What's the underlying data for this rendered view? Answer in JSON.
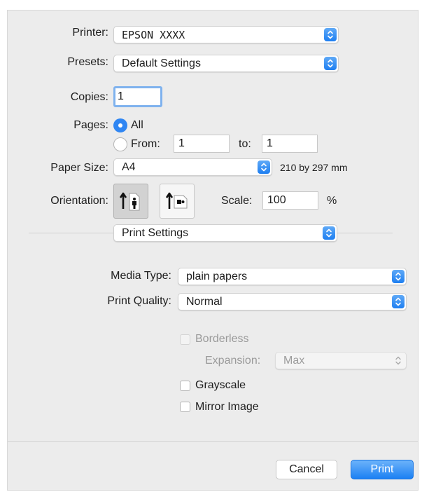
{
  "printer": {
    "label": "Printer:",
    "value": "EPSON XXXX"
  },
  "presets": {
    "label": "Presets:",
    "value": "Default Settings"
  },
  "copies": {
    "label": "Copies:",
    "value": "1"
  },
  "pages": {
    "label": "Pages:",
    "all_label": "All",
    "from_label": "From:",
    "from_value": "1",
    "to_label": "to:",
    "to_value": "1",
    "selected": "All"
  },
  "paper_size": {
    "label": "Paper Size:",
    "value": "A4",
    "dimensions": "210 by 297 mm"
  },
  "orientation": {
    "label": "Orientation:",
    "selected": "portrait",
    "options": [
      "portrait",
      "landscape"
    ]
  },
  "scale": {
    "label": "Scale:",
    "value": "100",
    "unit": "%"
  },
  "section": {
    "value": "Print Settings"
  },
  "media_type": {
    "label": "Media Type:",
    "value": "plain papers"
  },
  "print_quality": {
    "label": "Print Quality:",
    "value": "Normal"
  },
  "borderless": {
    "label": "Borderless",
    "checked": false,
    "enabled": false
  },
  "expansion": {
    "label": "Expansion:",
    "value": "Max",
    "enabled": false
  },
  "grayscale": {
    "label": "Grayscale",
    "checked": false
  },
  "mirror_image": {
    "label": "Mirror Image",
    "checked": false
  },
  "buttons": {
    "cancel": "Cancel",
    "print": "Print"
  },
  "colors": {
    "accent": "#2f86f3",
    "dialog_bg": "#ececec",
    "disabled_text": "#9a9a9a"
  }
}
